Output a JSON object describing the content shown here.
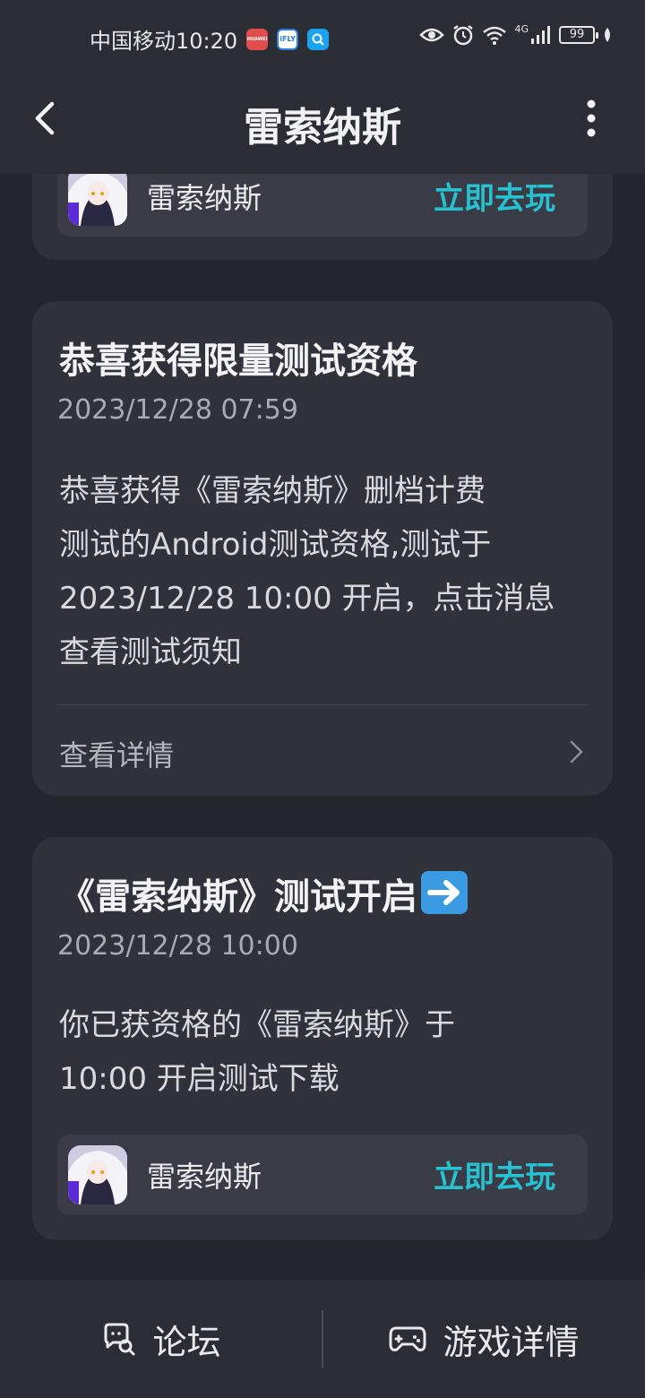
{
  "status_bar": {
    "carrier_time": "中国移动10:20",
    "app_icons": [
      "huawei-store-icon",
      "ifly-icon",
      "search-app-icon"
    ],
    "huawei_label": "HUAWEI",
    "ifly_label": "iFLY",
    "network": "4G",
    "battery": "99"
  },
  "app_bar": {
    "title": "雷索纳斯"
  },
  "top_card": {
    "game_name": "雷索纳斯",
    "play_label": "立即去玩"
  },
  "messages": [
    {
      "title": "恭喜获得限量测试资格",
      "time": "2023/12/28 07:59",
      "body_lines": [
        "恭喜获得《雷索纳斯》删档计费",
        "测试的Android测试资格,测试于",
        "2023/12/28 10:00 开启，点击消息",
        "查看测试须知"
      ],
      "detail_label": "查看详情"
    },
    {
      "title": "《雷索纳斯》测试开启",
      "time": "2023/12/28 10:00",
      "body_lines": [
        "你已获资格的《雷索纳斯》于",
        "10:00 开启测试下载"
      ],
      "game_name": "雷索纳斯",
      "play_label": "立即去玩"
    }
  ],
  "bottom_bar": {
    "forum_label": "论坛",
    "details_label": "游戏详情"
  },
  "colors": {
    "background": "#24262e",
    "card": "#2f313b",
    "accent": "#27c1d0"
  }
}
